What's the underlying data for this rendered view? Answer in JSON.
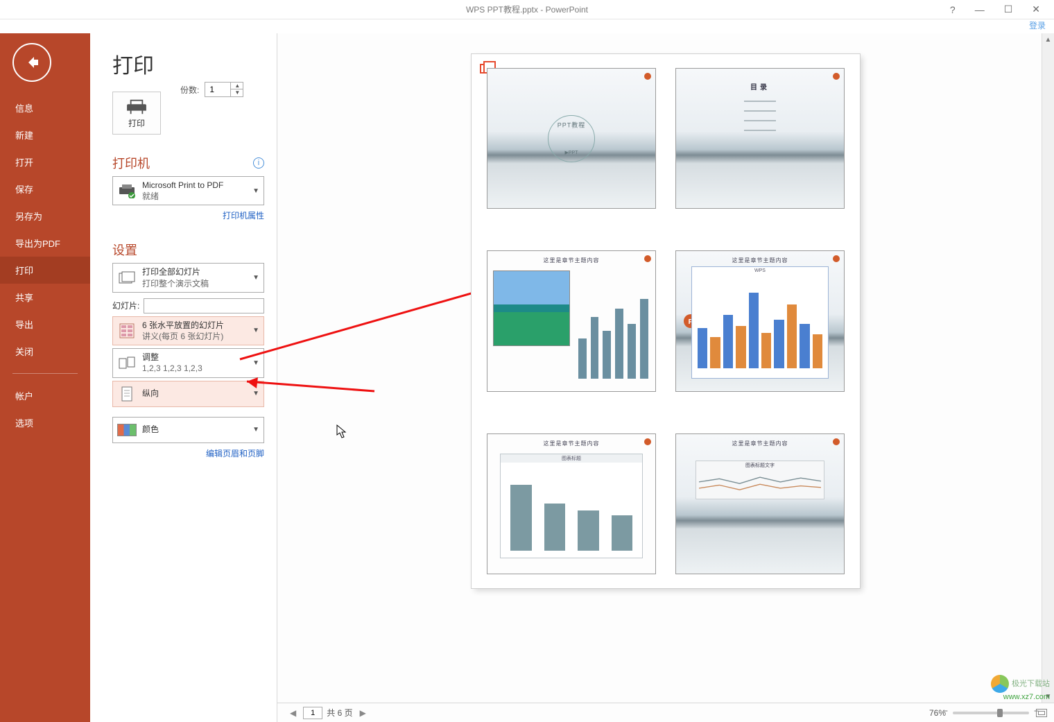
{
  "title": "WPS PPT教程.pptx - PowerPoint",
  "login_label": "登录",
  "window_controls": {
    "help": "?",
    "minimize": "—",
    "maximize": "☐",
    "close": "✕"
  },
  "sidebar": {
    "items": [
      {
        "label": "信息"
      },
      {
        "label": "新建"
      },
      {
        "label": "打开"
      },
      {
        "label": "保存"
      },
      {
        "label": "另存为"
      },
      {
        "label": "导出为PDF"
      },
      {
        "label": "打印",
        "active": true
      },
      {
        "label": "共享"
      },
      {
        "label": "导出"
      },
      {
        "label": "关闭"
      }
    ],
    "footer": [
      {
        "label": "帐户"
      },
      {
        "label": "选项"
      }
    ]
  },
  "print": {
    "page_title": "打印",
    "button_label": "打印",
    "copies_label": "份数:",
    "copies_value": "1",
    "printer_section": "打印机",
    "printer_name": "Microsoft Print to PDF",
    "printer_status": "就绪",
    "printer_props": "打印机属性",
    "settings_section": "设置",
    "range": {
      "title": "打印全部幻灯片",
      "sub": "打印整个演示文稿"
    },
    "slides_label": "幻灯片:",
    "slides_value": "",
    "layout": {
      "title": "6 张水平放置的幻灯片",
      "sub": "讲义(每页 6 张幻灯片)"
    },
    "collate": {
      "title": "调整",
      "sub": "1,2,3    1,2,3    1,2,3"
    },
    "orientation": {
      "title": "纵向"
    },
    "color": {
      "title": "颜色"
    },
    "edit_hf": "编辑页眉和页脚"
  },
  "status": {
    "page_current": "1",
    "page_total_label": "共 6 页",
    "zoom": "76%"
  },
  "preview": {
    "thumb1_label": "PPT教程",
    "thumb1_sub": "▶PPT",
    "thumb2_title": "目录",
    "thumb3_title": "这里是章节主题内容",
    "thumb4_title": "这里是章节主题内容",
    "thumb4_chart": "WPS",
    "thumb5_title": "这里是章节主题内容",
    "thumb5_chart": "图表标题",
    "thumb6_title": "这里是章节主题内容",
    "thumb6_chart": "图表标题文字"
  },
  "watermark": {
    "name": "极光下载站",
    "url": "www.xz7.com"
  }
}
